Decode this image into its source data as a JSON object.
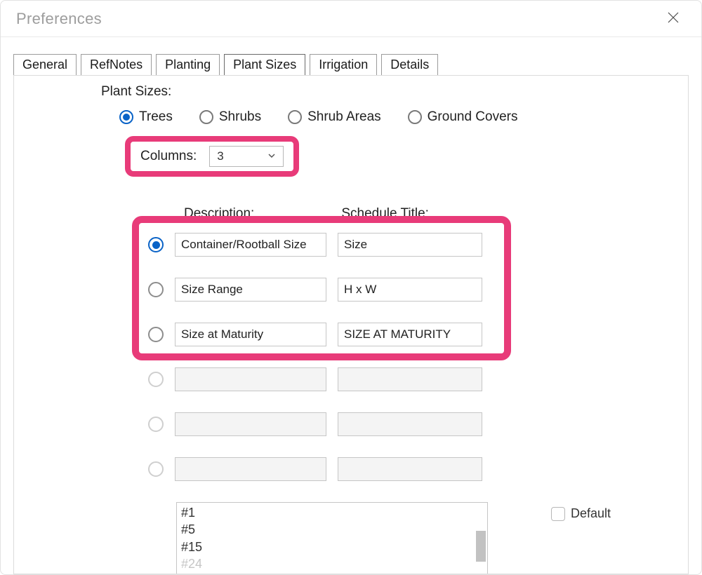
{
  "window": {
    "title": "Preferences"
  },
  "tabs": {
    "general": "General",
    "refnotes": "RefNotes",
    "planting": "Planting",
    "plant_sizes": "Plant Sizes",
    "irrigation": "Irrigation",
    "details": "Details",
    "active": "plant_sizes"
  },
  "section": {
    "title": "Plant Sizes:"
  },
  "types": {
    "trees": "Trees",
    "shrubs": "Shrubs",
    "shrub_areas": "Shrub Areas",
    "ground_covers": "Ground Covers",
    "selected": "trees"
  },
  "columns": {
    "label": "Columns:",
    "value": "3"
  },
  "headers": {
    "description": "Description:",
    "schedule_title": "Schedule Title:"
  },
  "rows": [
    {
      "selected": true,
      "enabled": true,
      "description": "Container/Rootball Size",
      "title": "Size"
    },
    {
      "selected": false,
      "enabled": true,
      "description": "Size Range",
      "title": "H x W"
    },
    {
      "selected": false,
      "enabled": true,
      "description": "Size at Maturity",
      "title": "SIZE AT MATURITY"
    },
    {
      "selected": false,
      "enabled": false,
      "description": "",
      "title": ""
    },
    {
      "selected": false,
      "enabled": false,
      "description": "",
      "title": ""
    },
    {
      "selected": false,
      "enabled": false,
      "description": "",
      "title": ""
    }
  ],
  "listbox": {
    "items": [
      "#1",
      "#5",
      "#15",
      "#24"
    ],
    "faded_from_index": 3
  },
  "default": {
    "label": "Default",
    "checked": false
  },
  "highlight_color": "#e83b79",
  "accent_color": "#0a63c7"
}
